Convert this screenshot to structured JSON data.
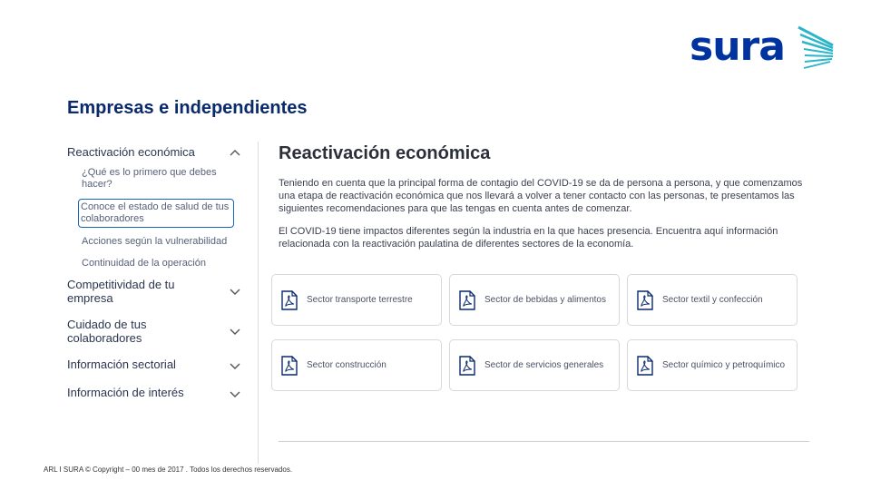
{
  "brand": {
    "logo_text": "sura",
    "color": "#0033a0",
    "accent": "#2bb5c9"
  },
  "page": {
    "title": "Empresas e independientes"
  },
  "sidebar": {
    "sections": [
      {
        "label": "Reactivación económica",
        "expanded": true,
        "icon": "chevron-up-icon"
      },
      {
        "label": "Competitividad de tu empresa",
        "expanded": false,
        "icon": "chevron-down-icon"
      },
      {
        "label": "Cuidado de tus colaboradores",
        "expanded": false,
        "icon": "chevron-down-icon"
      },
      {
        "label": "Información sectorial",
        "expanded": false,
        "icon": "chevron-down-icon"
      },
      {
        "label": "Información de interés",
        "expanded": false,
        "icon": "chevron-down-icon"
      }
    ],
    "sub_items": [
      {
        "label": "¿Qué es lo primero que debes hacer?",
        "active": false
      },
      {
        "label": "Conoce el estado de salud de tus colaboradores",
        "active": true
      },
      {
        "label": "Acciones según la vulnerabilidad",
        "active": false
      },
      {
        "label": "Continuidad de la operación",
        "active": false
      }
    ]
  },
  "main": {
    "heading": "Reactivación económica",
    "paragraph1": "Teniendo en cuenta que la principal forma de contagio del COVID-19 se da de persona a persona, y que comenzamos una etapa de reactivación económica que nos llevará a volver a tener contacto con las personas, te presentamos las siguientes recomendaciones para que las tengas en cuenta antes de comenzar.",
    "paragraph2": "El COVID-19 tiene impactos diferentes según la industria en la que haces presencia. Encuentra aquí información relacionada con la reactivación paulatina de diferentes sectores de la economía.",
    "cards": [
      {
        "label": "Sector transporte terrestre",
        "icon": "pdf-icon"
      },
      {
        "label": "Sector de bebidas y alimentos",
        "icon": "pdf-icon"
      },
      {
        "label": "Sector textil y confección",
        "icon": "pdf-icon"
      },
      {
        "label": "Sector construcción",
        "icon": "pdf-icon"
      },
      {
        "label": "Sector de servicios generales",
        "icon": "pdf-icon"
      },
      {
        "label": "Sector químico y petroquímico",
        "icon": "pdf-icon"
      }
    ]
  },
  "footer": {
    "text": "ARL I SURA © Copyright – 00 mes de 2017 . Todos los derechos reservados."
  }
}
